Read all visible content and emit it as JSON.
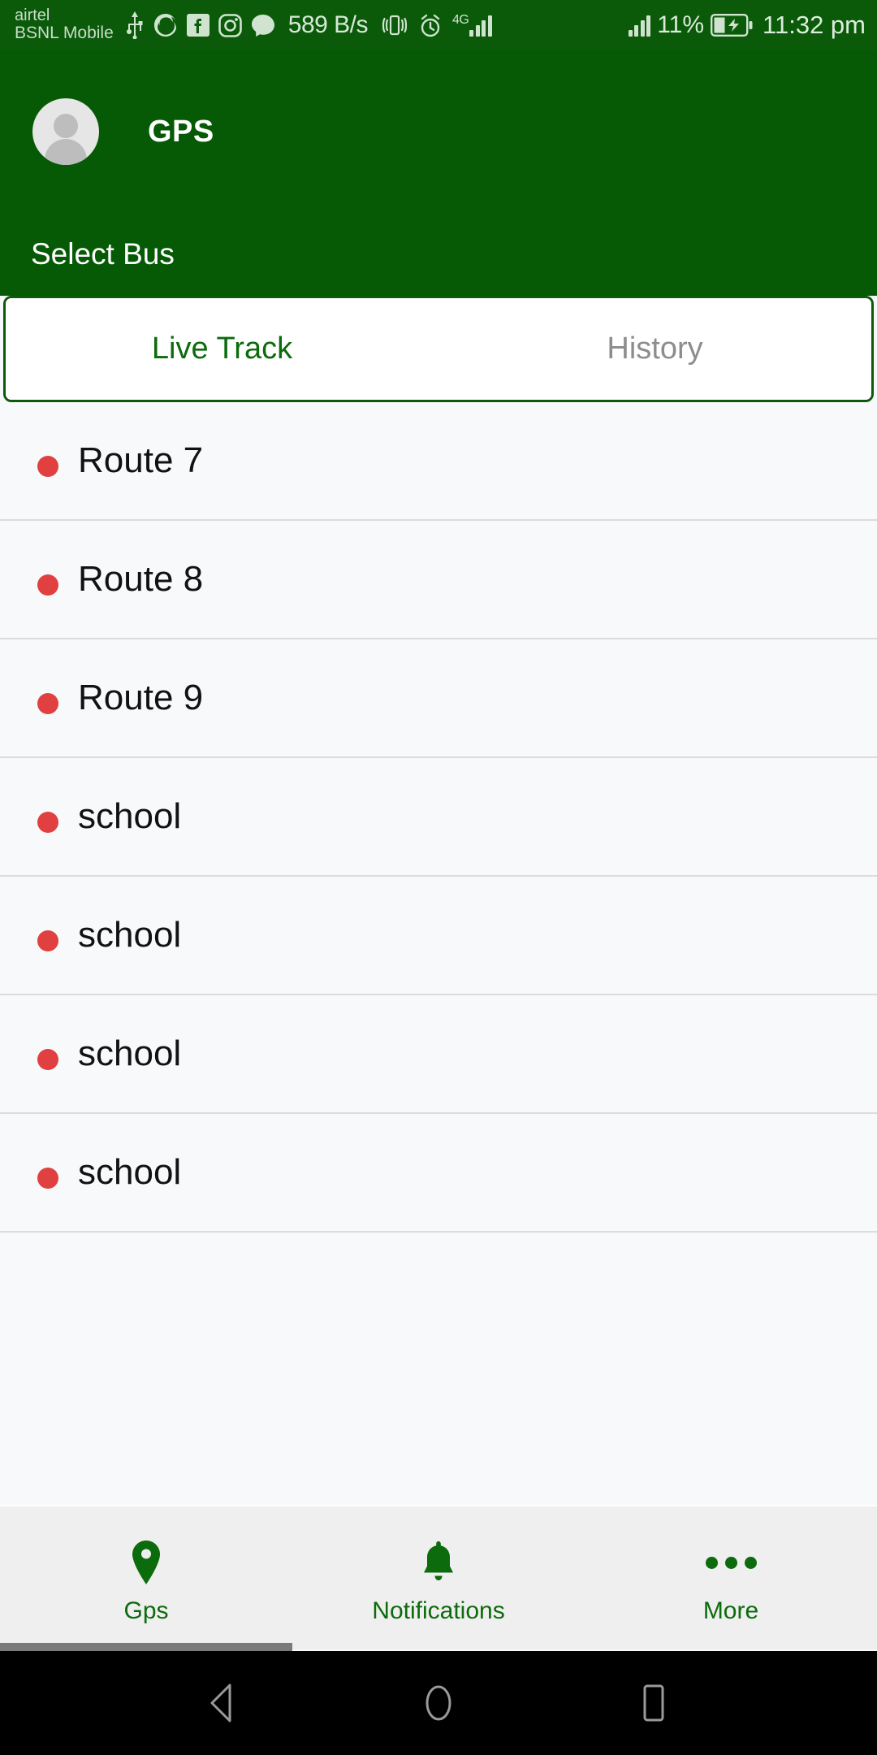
{
  "status_bar": {
    "carrier_line1": "airtel",
    "carrier_line2": "BSNL Mobile",
    "network_speed": "589 B/s",
    "network_type": "4G",
    "battery_percent": "11%",
    "clock": "11:32 pm",
    "icons": [
      "usb-icon",
      "firefox-icon",
      "facebook-icon",
      "instagram-icon",
      "messenger-icon",
      "vibrate-icon",
      "alarm-icon",
      "signal-icon",
      "signal-icon",
      "battery-charging-icon"
    ],
    "background_color": "#0a5a0a",
    "text_color": "#cfe3cf"
  },
  "app_bar": {
    "title": "GPS",
    "avatar": "user-avatar-icon",
    "background_color": "#065a06"
  },
  "select_bar": {
    "label": "Select Bus"
  },
  "tabs": {
    "items": [
      {
        "label": "Live Track",
        "active": true
      },
      {
        "label": "History",
        "active": false
      }
    ],
    "active_color": "#0c6b0c",
    "inactive_color": "#8d8d8d",
    "border_color": "#0c5a0c"
  },
  "bus_list": {
    "dot_color": "#e04040",
    "rows": [
      {
        "label": "Route 7"
      },
      {
        "label": "Route 8"
      },
      {
        "label": "Route 9"
      },
      {
        "label": "school"
      },
      {
        "label": "school"
      },
      {
        "label": "school"
      },
      {
        "label": "school"
      }
    ]
  },
  "bottom_nav": {
    "items": [
      {
        "label": "Gps",
        "icon": "map-pin-icon",
        "active": true
      },
      {
        "label": "Notifications",
        "icon": "bell-icon",
        "active": false
      },
      {
        "label": "More",
        "icon": "more-horizontal-icon",
        "active": false
      }
    ],
    "color": "#0c6b0c",
    "background_color": "#efefef"
  },
  "android_nav": {
    "buttons": [
      "back-icon",
      "home-icon",
      "recents-icon"
    ]
  }
}
